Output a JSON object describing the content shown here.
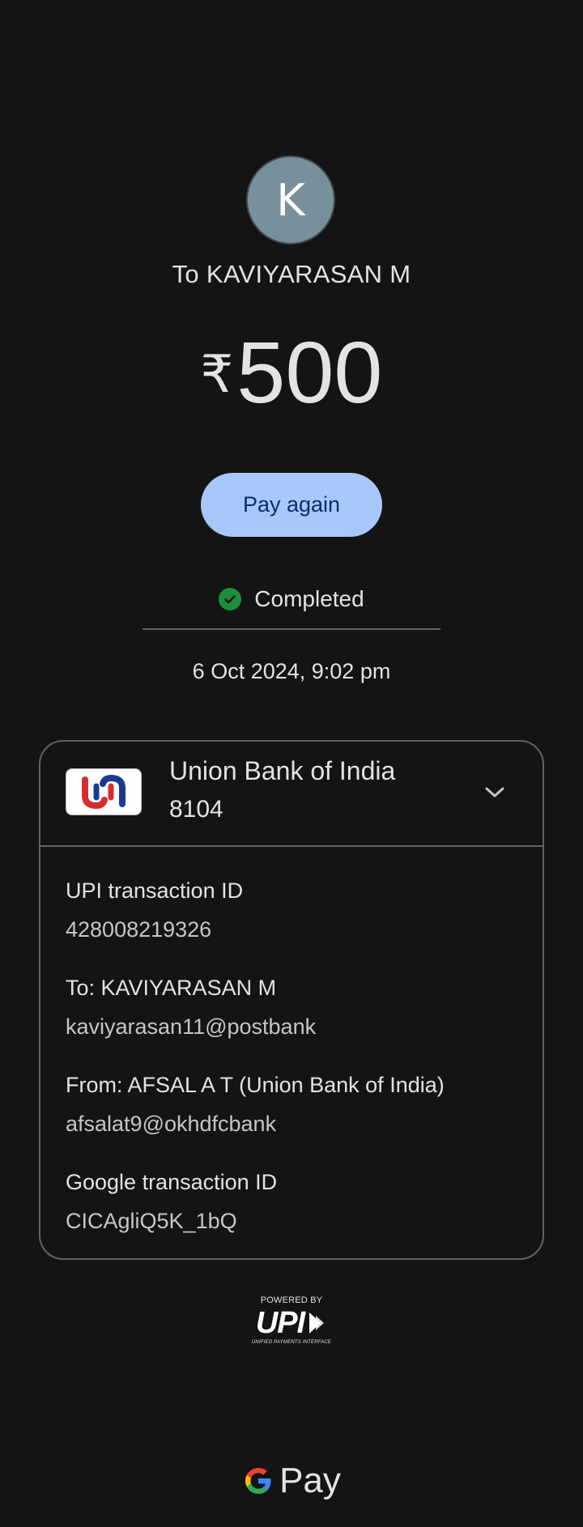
{
  "recipient": {
    "initial": "K",
    "to_label": "To KAVIYARASAN M",
    "avatar_color": "#78909c"
  },
  "payment": {
    "currency_symbol": "₹",
    "amount": "500",
    "pay_again_label": "Pay again",
    "status": "Completed",
    "status_color": "#1e8e3e",
    "datetime": "6 Oct 2024, 9:02 pm"
  },
  "bank": {
    "name": "Union Bank of India",
    "account_suffix": "8104",
    "logo_icon": "union-bank-logo"
  },
  "details": [
    {
      "label": "UPI transaction ID",
      "value": "428008219326"
    },
    {
      "label": "To: KAVIYARASAN M",
      "value": "kaviyarasan11@postbank"
    },
    {
      "label": "From: AFSAL A T (Union Bank of India)",
      "value": "afsalat9@okhdfcbank"
    },
    {
      "label": "Google transaction ID",
      "value": "CICAgliQ5K_1bQ"
    }
  ],
  "footer": {
    "powered_by": "POWERED BY",
    "upi_mark": "UPI",
    "upi_subtitle": "UNIFIED PAYMENTS INTERFACE",
    "gpay_word": "Pay"
  },
  "colors": {
    "background": "#141414",
    "accent_button": "#a8c7fa",
    "accent_button_text": "#062e6f"
  }
}
